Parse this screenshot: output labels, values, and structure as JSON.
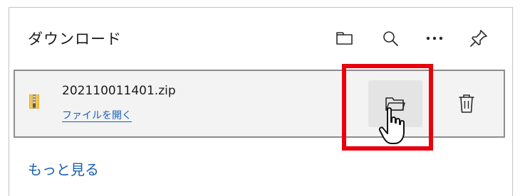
{
  "panel": {
    "title": "ダウンロード",
    "header_icons": [
      "folder-icon",
      "search-icon",
      "more-icon",
      "pin-icon"
    ]
  },
  "download_item": {
    "file_icon": "zip-file-icon",
    "filename": "202110011401.zip",
    "open_file_label": "ファイルを開く",
    "action_icons": [
      "folder-icon",
      "trash-icon"
    ]
  },
  "footer": {
    "more_label": "もっと見る"
  },
  "colors": {
    "link": "#1a5fb4",
    "highlight": "#e8000b",
    "item_bg": "#f3f3f3",
    "item_border": "#8d8d8d"
  }
}
